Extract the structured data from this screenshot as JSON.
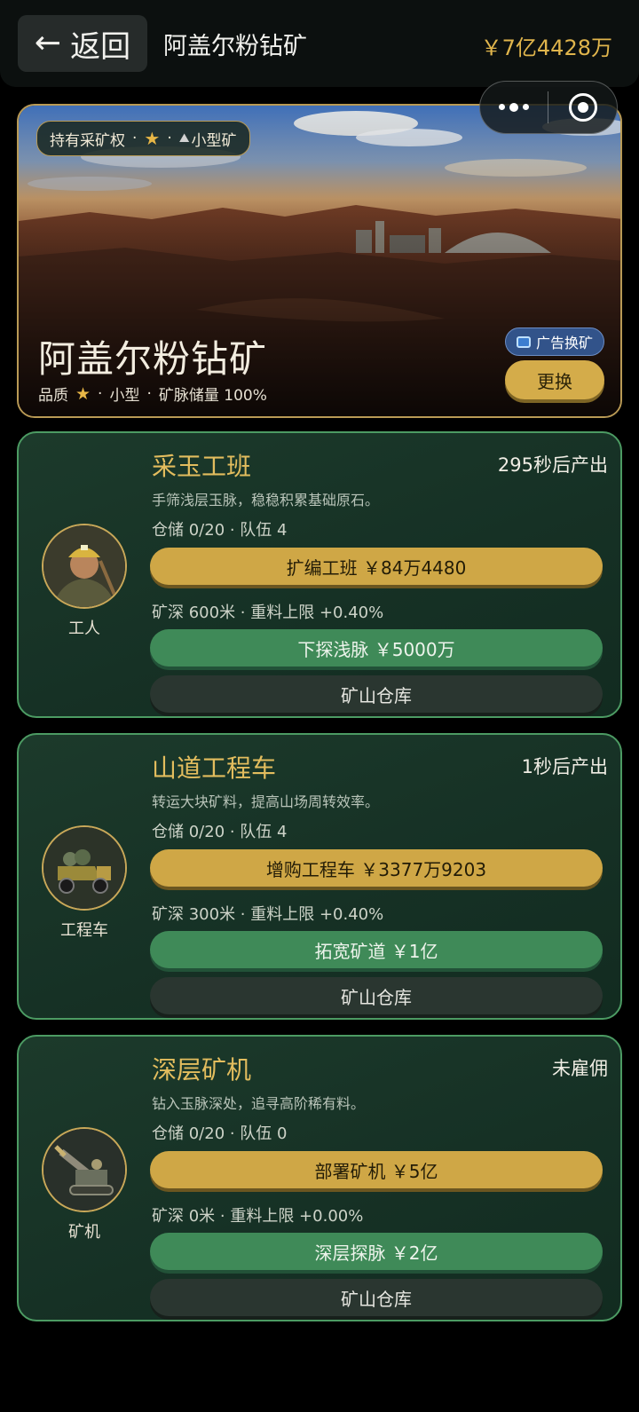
{
  "header": {
    "back_icon": "arrow-left-icon",
    "back_label": "返回",
    "title": "阿盖尔粉钻矿",
    "balance": "￥7亿4428万"
  },
  "capsule": {
    "more_icon": "more-dots-icon",
    "close_icon": "target-circle-icon"
  },
  "hero": {
    "tag": {
      "ownership": "持有采矿权",
      "dot": "·",
      "star": "★",
      "size_icon": "mountain-icon",
      "size": "小型矿"
    },
    "name": "阿盖尔粉钻矿",
    "meta": {
      "quality_label": "品质",
      "star": "★",
      "size": "小型",
      "reserve": "矿脉储量 100%",
      "dot": "·"
    },
    "ad_button": "广告换矿",
    "swap_button": "更换"
  },
  "units": [
    {
      "name": "采玉工班",
      "timer": "295秒后产出",
      "description": "手筛浅层玉脉，稳稳积累基础原石。",
      "stats": "仓储 0/20 · 队伍 4",
      "upgrade_button": "扩编工班 ￥84万4480",
      "depth": "矿深 600米 · 重料上限 +0.40%",
      "dig_button": "下探浅脉 ￥5000万",
      "storage_button": "矿山仓库",
      "avatar_label": "工人",
      "avatar_icon": "miner-portrait-icon"
    },
    {
      "name": "山道工程车",
      "timer": "1秒后产出",
      "description": "转运大块矿料，提高山场周转效率。",
      "stats": "仓储 0/20 · 队伍 4",
      "upgrade_button": "增购工程车 ￥3377万9203",
      "depth": "矿深 300米 · 重料上限 +0.40%",
      "dig_button": "拓宽矿道 ￥1亿",
      "storage_button": "矿山仓库",
      "avatar_label": "工程车",
      "avatar_icon": "dump-truck-icon"
    },
    {
      "name": "深层矿机",
      "timer": "未雇佣",
      "description": "钻入玉脉深处，追寻高阶稀有料。",
      "stats": "仓储 0/20 · 队伍 0",
      "upgrade_button": "部署矿机 ￥5亿",
      "depth": "矿深 0米 · 重料上限 +0.00%",
      "dig_button": "深层探脉 ￥2亿",
      "storage_button": "矿山仓库",
      "avatar_label": "矿机",
      "avatar_icon": "drill-machine-icon"
    }
  ]
}
